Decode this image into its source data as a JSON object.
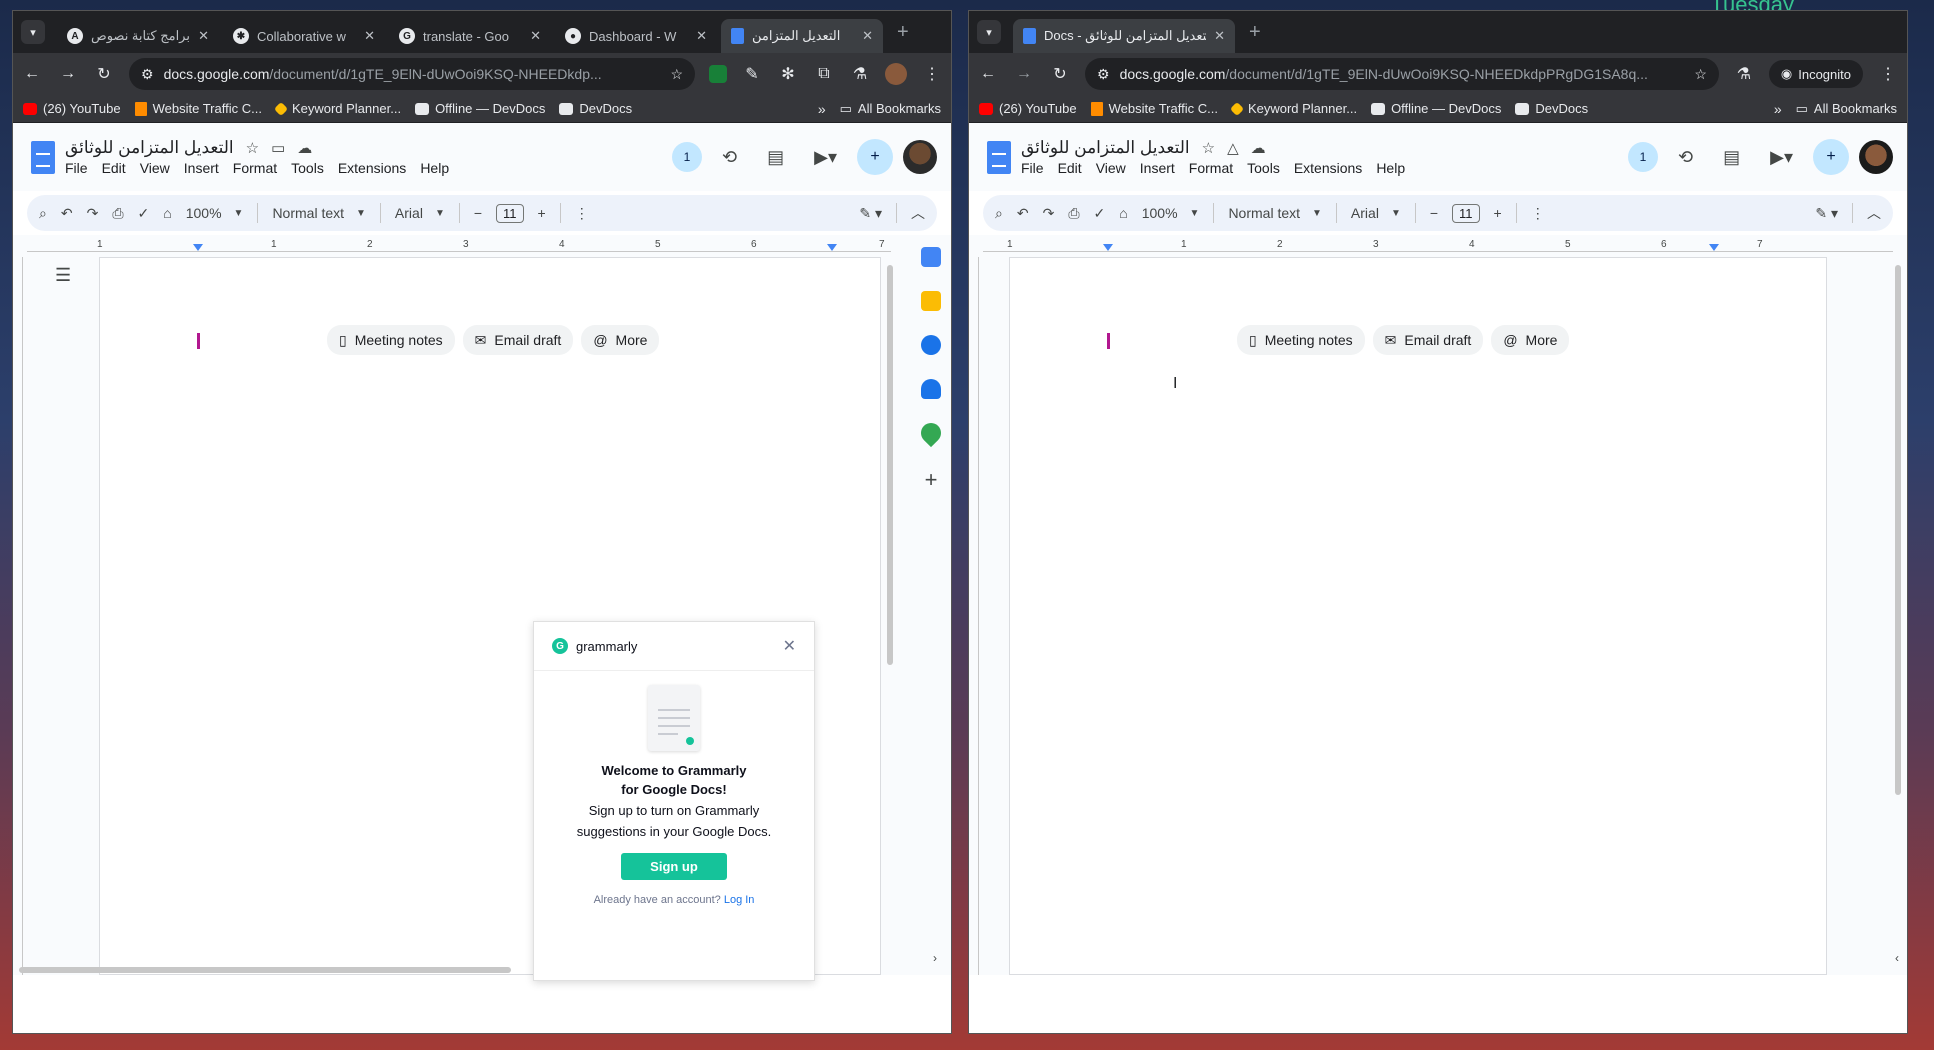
{
  "desktop": {
    "clock_label": "Tuesday"
  },
  "left": {
    "tabs": [
      {
        "title": "برامج كتابة نصوص",
        "icon": "ai-writer-icon"
      },
      {
        "title": "Collaborative w",
        "icon": "openai-icon"
      },
      {
        "title": "translate - Goo",
        "icon": "google-icon"
      },
      {
        "title": "Dashboard - W",
        "icon": "github-icon"
      },
      {
        "title": "التعديل المتزامن",
        "icon": "docs-icon",
        "active": true
      }
    ],
    "url_host": "docs.google.com",
    "url_path": "/document/d/1gTE_9ElN-dUwOoi9KSQ-NHEEDkdp...",
    "bookmarks": [
      "(26) YouTube",
      "Website Traffic C...",
      "Keyword Planner...",
      "Offline — DevDocs",
      "DevDocs"
    ],
    "all_bookmarks": "All Bookmarks",
    "doc_title": "التعديل المتزامن للوثائق",
    "menus": [
      "File",
      "Edit",
      "View",
      "Insert",
      "Format",
      "Tools",
      "Extensions",
      "Help"
    ],
    "collaborators_count": "1",
    "zoom": "100%",
    "style": "Normal text",
    "font": "Arial",
    "font_size": "11",
    "ruler_nums": [
      "1",
      "1",
      "2",
      "3",
      "4",
      "5",
      "6",
      "7"
    ],
    "chips": [
      "Meeting notes",
      "Email draft",
      "More"
    ],
    "grammarly": {
      "brand": "grammarly",
      "title_1": "Welcome to Grammarly",
      "title_2": "for Google Docs!",
      "text_1": "Sign up to turn on Grammarly",
      "text_2": "suggestions in your Google Docs.",
      "signup": "Sign up",
      "login_prompt": "Already have an account?",
      "login_link": "Log In"
    }
  },
  "right": {
    "tab_title": "Docs - التعديل المتزامن للوثائق",
    "url_host": "docs.google.com",
    "url_path": "/document/d/1gTE_9ElN-dUwOoi9KSQ-NHEEDkdpPRgDG1SA8q...",
    "incognito": "Incognito",
    "bookmarks": [
      "(26) YouTube",
      "Website Traffic C...",
      "Keyword Planner...",
      "Offline — DevDocs",
      "DevDocs"
    ],
    "all_bookmarks": "All Bookmarks",
    "doc_title": "التعديل المتزامن للوثائق",
    "menus": [
      "File",
      "Edit",
      "View",
      "Insert",
      "Format",
      "Tools",
      "Extensions",
      "Help"
    ],
    "collaborators_count": "1",
    "zoom": "100%",
    "style": "Normal text",
    "font": "Arial",
    "font_size": "11",
    "ruler_nums": [
      "1",
      "1",
      "2",
      "3",
      "4",
      "5",
      "6",
      "7"
    ],
    "chips": [
      "Meeting notes",
      "Email draft",
      "More"
    ]
  }
}
